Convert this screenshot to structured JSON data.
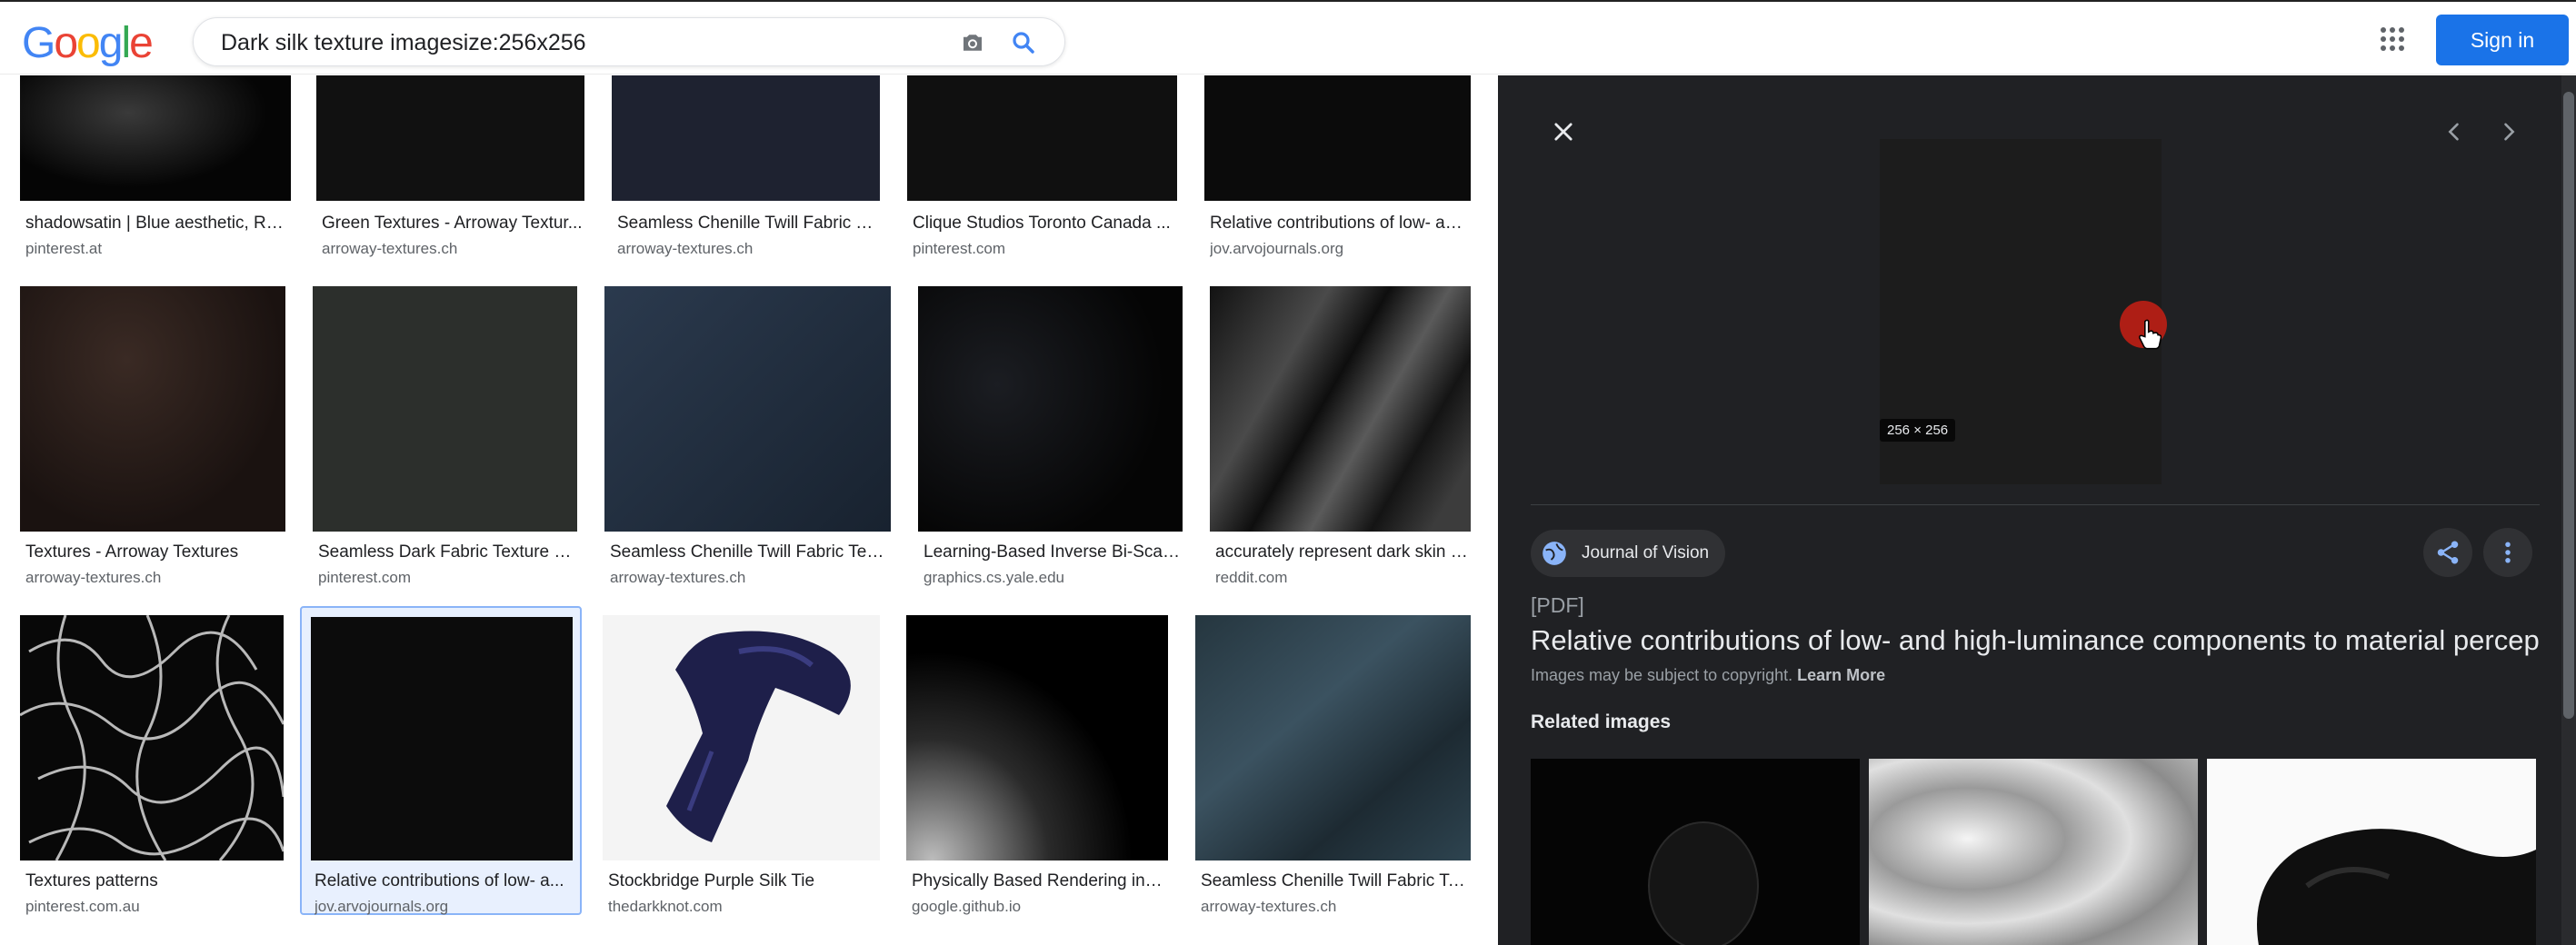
{
  "search": {
    "query": "Dark silk texture imagesize:256x256",
    "logo": [
      "G",
      "o",
      "o",
      "g",
      "l",
      "e"
    ],
    "logo_colors": [
      "#4285f4",
      "#ea4335",
      "#fbbc05",
      "#4285f4",
      "#34a853",
      "#ea4335"
    ]
  },
  "header": {
    "signin_label": "Sign in"
  },
  "grid": {
    "row1": [
      {
        "title": "shadowsatin | Blue aesthetic, Re...",
        "source": "pinterest.at"
      },
      {
        "title": "Green Textures - Arroway Textur...",
        "source": "arroway-textures.ch"
      },
      {
        "title": "Seamless Chenille Twill Fabric T...",
        "source": "arroway-textures.ch"
      },
      {
        "title": "Clique Studios Toronto Canada ...",
        "source": "pinterest.com"
      },
      {
        "title": "Relative contributions of low- an...",
        "source": "jov.arvojournals.org"
      }
    ],
    "row2": [
      {
        "title": "Textures - Arroway Textures",
        "source": "arroway-textures.ch"
      },
      {
        "title": "Seamless Dark Fabric Texture | ...",
        "source": "pinterest.com"
      },
      {
        "title": "Seamless Chenille Twill Fabric Tex...",
        "source": "arroway-textures.ch"
      },
      {
        "title": "Learning-Based Inverse Bi-Scale...",
        "source": "graphics.cs.yale.edu"
      },
      {
        "title": "accurately represent dark skin t...",
        "source": "reddit.com"
      }
    ],
    "row3": [
      {
        "title": "Textures patterns",
        "source": "pinterest.com.au"
      },
      {
        "title": "Relative contributions of low- a...",
        "source": "jov.arvojournals.org"
      },
      {
        "title": "Stockbridge Purple Silk Tie",
        "source": "thedarkknot.com"
      },
      {
        "title": "Physically Based Rendering in F...",
        "source": "google.github.io"
      },
      {
        "title": "Seamless Chenille Twill Fabric Te...",
        "source": "arroway-textures.ch"
      }
    ]
  },
  "panel": {
    "size_label": "256 × 256",
    "source_name": "Journal of Vision",
    "type_label": "[PDF]",
    "title": "Relative contributions of low- and high-luminance components to material percepti",
    "copyright_text": "Images may be subject to copyright.",
    "learn_more": "Learn More",
    "related_label": "Related images"
  }
}
